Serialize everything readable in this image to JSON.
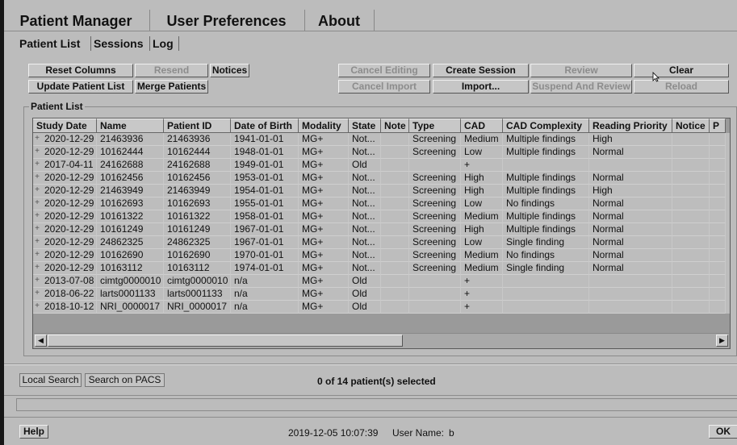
{
  "main_tabs": [
    "Patient Manager",
    "User Preferences",
    "About"
  ],
  "sub_tabs": [
    "Patient List",
    "Sessions",
    "Log"
  ],
  "left_buttons": {
    "reset_columns": "Reset Columns",
    "resend": "Resend",
    "notices": "Notices",
    "update_patient_list": "Update Patient List",
    "merge_patients": "Merge Patients"
  },
  "right_buttons": {
    "cancel_editing": "Cancel Editing",
    "create_session": "Create Session",
    "review": "Review",
    "clear": "Clear",
    "cancel_import": "Cancel Import",
    "import": "Import...",
    "suspend_and_review": "Suspend And Review",
    "reload": "Reload"
  },
  "patient_list": {
    "group_title": "Patient List",
    "columns": [
      "Study Date",
      "Name",
      "Patient ID",
      "Date of Birth",
      "Modality",
      "State",
      "Note",
      "Type",
      "CAD",
      "CAD Complexity",
      "Reading Priority",
      "Notice",
      "P"
    ],
    "rows": [
      [
        "2020-12-29",
        "21463936",
        "21463936",
        "1941-01-01",
        "MG+",
        "Not...",
        "",
        "Screening",
        "Medium",
        "Multiple findings",
        "High",
        "",
        ""
      ],
      [
        "2020-12-29",
        "10162444",
        "10162444",
        "1948-01-01",
        "MG+",
        "Not...",
        "",
        "Screening",
        "Low",
        "Multiple findings",
        "Normal",
        "",
        ""
      ],
      [
        "2017-04-11",
        "24162688",
        "24162688",
        "1949-01-01",
        "MG+",
        "Old",
        "",
        "",
        "+",
        "",
        "",
        "",
        ""
      ],
      [
        "2020-12-29",
        "10162456",
        "10162456",
        "1953-01-01",
        "MG+",
        "Not...",
        "",
        "Screening",
        "High",
        "Multiple findings",
        "Normal",
        "",
        ""
      ],
      [
        "2020-12-29",
        "21463949",
        "21463949",
        "1954-01-01",
        "MG+",
        "Not...",
        "",
        "Screening",
        "High",
        "Multiple findings",
        "High",
        "",
        ""
      ],
      [
        "2020-12-29",
        "10162693",
        "10162693",
        "1955-01-01",
        "MG+",
        "Not...",
        "",
        "Screening",
        "Low",
        "No findings",
        "Normal",
        "",
        ""
      ],
      [
        "2020-12-29",
        "10161322",
        "10161322",
        "1958-01-01",
        "MG+",
        "Not...",
        "",
        "Screening",
        "Medium",
        "Multiple findings",
        "Normal",
        "",
        ""
      ],
      [
        "2020-12-29",
        "10161249",
        "10161249",
        "1967-01-01",
        "MG+",
        "Not...",
        "",
        "Screening",
        "High",
        "Multiple findings",
        "Normal",
        "",
        ""
      ],
      [
        "2020-12-29",
        "24862325",
        "24862325",
        "1967-01-01",
        "MG+",
        "Not...",
        "",
        "Screening",
        "Low",
        "Single finding",
        "Normal",
        "",
        ""
      ],
      [
        "2020-12-29",
        "10162690",
        "10162690",
        "1970-01-01",
        "MG+",
        "Not...",
        "",
        "Screening",
        "Medium",
        "No findings",
        "Normal",
        "",
        ""
      ],
      [
        "2020-12-29",
        "10163112",
        "10163112",
        "1974-01-01",
        "MG+",
        "Not...",
        "",
        "Screening",
        "Medium",
        "Single finding",
        "Normal",
        "",
        ""
      ],
      [
        "2013-07-08",
        "cimtg0000010",
        "cimtg0000010",
        "n/a",
        "MG+",
        "Old",
        "",
        "",
        "+",
        "",
        "",
        "",
        ""
      ],
      [
        "2018-06-22",
        "larts0001133",
        "larts0001133",
        "n/a",
        "MG+",
        "Old",
        "",
        "",
        "+",
        "",
        "",
        "",
        ""
      ],
      [
        "2018-10-12",
        "NRI_0000017",
        "NRI_0000017",
        "n/a",
        "MG+",
        "Old",
        "",
        "",
        "+",
        "",
        "",
        "",
        ""
      ]
    ]
  },
  "search": {
    "local_search": "Local Search",
    "search_on_pacs": "Search on PACS",
    "selection_status": "0 of 14 patient(s) selected"
  },
  "footer": {
    "help": "Help",
    "datetime": "2019-12-05 10:07:39",
    "user_label": "User Name:",
    "user_name": "b",
    "ok": "OK"
  },
  "icons": {
    "scroll_left": "left-arrow-icon",
    "scroll_right": "right-arrow-icon",
    "row_expander": "plus-icon"
  }
}
